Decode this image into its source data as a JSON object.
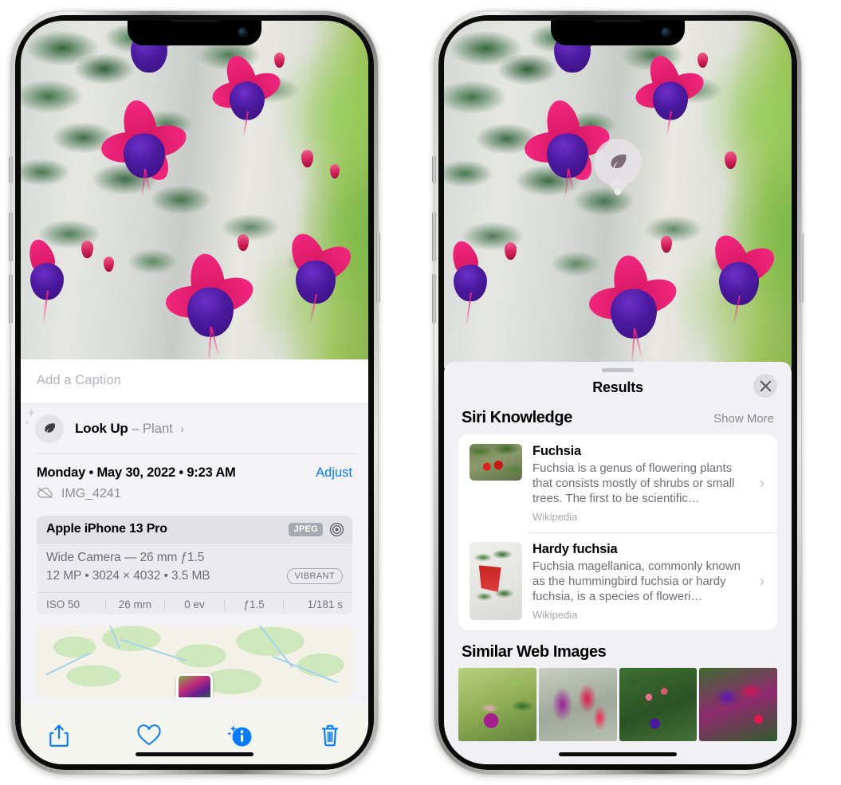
{
  "left_phone": {
    "caption": {
      "placeholder": "Add a Caption",
      "value": ""
    },
    "lookup": {
      "icon": "leaf-icon",
      "label": "Look Up",
      "dash": "–",
      "subject": "Plant",
      "chevron": "›"
    },
    "metadata": {
      "date_line": "Monday • May 30, 2022 • 9:23 AM",
      "adjust_label": "Adjust",
      "filename": "IMG_4241",
      "cloud_icon": "icloud-slash-icon"
    },
    "camera_card": {
      "device": "Apple iPhone 13 Pro",
      "format_tag": "JPEG",
      "aperture_icon": "aperture-icon",
      "lens_line": "Wide Camera — 26 mm ƒ1.5",
      "size_line": "12 MP • 3024 × 4032 • 3.5 MB",
      "style_pill": "VIBRANT",
      "exif": [
        "ISO 50",
        "26 mm",
        "0 ev",
        "ƒ1.5",
        "1/181 s"
      ]
    },
    "map": {
      "pin_label": "photo-pin"
    },
    "toolbar": [
      {
        "name": "share-icon",
        "label": "Share"
      },
      {
        "name": "favorite-heart-icon",
        "label": "Favorite"
      },
      {
        "name": "info-sparkle-icon",
        "label": "Info"
      },
      {
        "name": "trash-icon",
        "label": "Delete"
      }
    ]
  },
  "right_phone": {
    "visual_lookup_badge": {
      "icon": "leaf-icon",
      "label": "Plant"
    },
    "sheet": {
      "title": "Results",
      "close_icon": "close-icon",
      "sections": [
        {
          "title": "Siri Knowledge",
          "action": "Show More",
          "items": [
            {
              "title": "Fuchsia",
              "description": "Fuchsia is a genus of flowering plants that consists mostly of shrubs or small trees. The first to be scientific…",
              "source": "Wikipedia",
              "chevron": "›"
            },
            {
              "title": "Hardy fuchsia",
              "description": "Fuchsia magellanica, commonly known as the hummingbird fuchsia or hardy fuchsia, is a species of floweri…",
              "source": "Wikipedia",
              "chevron": "›"
            }
          ]
        },
        {
          "title": "Similar Web Images",
          "items": [
            {
              "alt": "fuchsia-thumb-1"
            },
            {
              "alt": "fuchsia-thumb-2"
            },
            {
              "alt": "fuchsia-thumb-3"
            },
            {
              "alt": "fuchsia-thumb-4"
            }
          ]
        }
      ]
    }
  },
  "colors": {
    "accent_blue": "#067cfd",
    "sheet_bg": "#f2f2f7",
    "results_bg": "#f0f0f5",
    "card_bg": "#ffffff",
    "secondary_text": "#8e8e93"
  }
}
